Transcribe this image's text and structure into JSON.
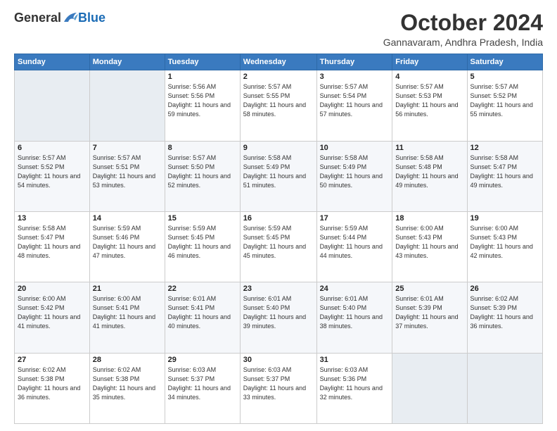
{
  "header": {
    "logo_general": "General",
    "logo_blue": "Blue",
    "month_title": "October 2024",
    "location": "Gannavaram, Andhra Pradesh, India"
  },
  "weekdays": [
    "Sunday",
    "Monday",
    "Tuesday",
    "Wednesday",
    "Thursday",
    "Friday",
    "Saturday"
  ],
  "weeks": [
    [
      {
        "day": "",
        "info": ""
      },
      {
        "day": "",
        "info": ""
      },
      {
        "day": "1",
        "info": "Sunrise: 5:56 AM\nSunset: 5:56 PM\nDaylight: 11 hours and 59 minutes."
      },
      {
        "day": "2",
        "info": "Sunrise: 5:57 AM\nSunset: 5:55 PM\nDaylight: 11 hours and 58 minutes."
      },
      {
        "day": "3",
        "info": "Sunrise: 5:57 AM\nSunset: 5:54 PM\nDaylight: 11 hours and 57 minutes."
      },
      {
        "day": "4",
        "info": "Sunrise: 5:57 AM\nSunset: 5:53 PM\nDaylight: 11 hours and 56 minutes."
      },
      {
        "day": "5",
        "info": "Sunrise: 5:57 AM\nSunset: 5:52 PM\nDaylight: 11 hours and 55 minutes."
      }
    ],
    [
      {
        "day": "6",
        "info": "Sunrise: 5:57 AM\nSunset: 5:52 PM\nDaylight: 11 hours and 54 minutes."
      },
      {
        "day": "7",
        "info": "Sunrise: 5:57 AM\nSunset: 5:51 PM\nDaylight: 11 hours and 53 minutes."
      },
      {
        "day": "8",
        "info": "Sunrise: 5:57 AM\nSunset: 5:50 PM\nDaylight: 11 hours and 52 minutes."
      },
      {
        "day": "9",
        "info": "Sunrise: 5:58 AM\nSunset: 5:49 PM\nDaylight: 11 hours and 51 minutes."
      },
      {
        "day": "10",
        "info": "Sunrise: 5:58 AM\nSunset: 5:49 PM\nDaylight: 11 hours and 50 minutes."
      },
      {
        "day": "11",
        "info": "Sunrise: 5:58 AM\nSunset: 5:48 PM\nDaylight: 11 hours and 49 minutes."
      },
      {
        "day": "12",
        "info": "Sunrise: 5:58 AM\nSunset: 5:47 PM\nDaylight: 11 hours and 49 minutes."
      }
    ],
    [
      {
        "day": "13",
        "info": "Sunrise: 5:58 AM\nSunset: 5:47 PM\nDaylight: 11 hours and 48 minutes."
      },
      {
        "day": "14",
        "info": "Sunrise: 5:59 AM\nSunset: 5:46 PM\nDaylight: 11 hours and 47 minutes."
      },
      {
        "day": "15",
        "info": "Sunrise: 5:59 AM\nSunset: 5:45 PM\nDaylight: 11 hours and 46 minutes."
      },
      {
        "day": "16",
        "info": "Sunrise: 5:59 AM\nSunset: 5:45 PM\nDaylight: 11 hours and 45 minutes."
      },
      {
        "day": "17",
        "info": "Sunrise: 5:59 AM\nSunset: 5:44 PM\nDaylight: 11 hours and 44 minutes."
      },
      {
        "day": "18",
        "info": "Sunrise: 6:00 AM\nSunset: 5:43 PM\nDaylight: 11 hours and 43 minutes."
      },
      {
        "day": "19",
        "info": "Sunrise: 6:00 AM\nSunset: 5:43 PM\nDaylight: 11 hours and 42 minutes."
      }
    ],
    [
      {
        "day": "20",
        "info": "Sunrise: 6:00 AM\nSunset: 5:42 PM\nDaylight: 11 hours and 41 minutes."
      },
      {
        "day": "21",
        "info": "Sunrise: 6:00 AM\nSunset: 5:41 PM\nDaylight: 11 hours and 41 minutes."
      },
      {
        "day": "22",
        "info": "Sunrise: 6:01 AM\nSunset: 5:41 PM\nDaylight: 11 hours and 40 minutes."
      },
      {
        "day": "23",
        "info": "Sunrise: 6:01 AM\nSunset: 5:40 PM\nDaylight: 11 hours and 39 minutes."
      },
      {
        "day": "24",
        "info": "Sunrise: 6:01 AM\nSunset: 5:40 PM\nDaylight: 11 hours and 38 minutes."
      },
      {
        "day": "25",
        "info": "Sunrise: 6:01 AM\nSunset: 5:39 PM\nDaylight: 11 hours and 37 minutes."
      },
      {
        "day": "26",
        "info": "Sunrise: 6:02 AM\nSunset: 5:39 PM\nDaylight: 11 hours and 36 minutes."
      }
    ],
    [
      {
        "day": "27",
        "info": "Sunrise: 6:02 AM\nSunset: 5:38 PM\nDaylight: 11 hours and 36 minutes."
      },
      {
        "day": "28",
        "info": "Sunrise: 6:02 AM\nSunset: 5:38 PM\nDaylight: 11 hours and 35 minutes."
      },
      {
        "day": "29",
        "info": "Sunrise: 6:03 AM\nSunset: 5:37 PM\nDaylight: 11 hours and 34 minutes."
      },
      {
        "day": "30",
        "info": "Sunrise: 6:03 AM\nSunset: 5:37 PM\nDaylight: 11 hours and 33 minutes."
      },
      {
        "day": "31",
        "info": "Sunrise: 6:03 AM\nSunset: 5:36 PM\nDaylight: 11 hours and 32 minutes."
      },
      {
        "day": "",
        "info": ""
      },
      {
        "day": "",
        "info": ""
      }
    ]
  ]
}
